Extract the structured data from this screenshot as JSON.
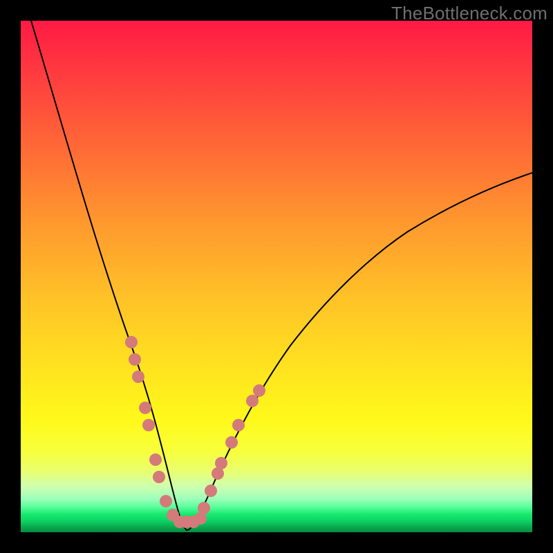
{
  "watermark": "TheBottleneck.com",
  "colors": {
    "background": "#000000",
    "gradient_top": "#ff1a44",
    "gradient_mid": "#ffe31f",
    "gradient_bottom": "#078c41",
    "curve": "#000000",
    "marker": "#d47a7a"
  },
  "chart_data": {
    "type": "line",
    "title": "",
    "xlabel": "",
    "ylabel": "",
    "xlim": [
      0,
      100
    ],
    "ylim": [
      0,
      100
    ],
    "grid": false,
    "legend": false,
    "annotations": [
      "TheBottleneck.com"
    ],
    "series": [
      {
        "name": "curve",
        "x": [
          2,
          5,
          8,
          11,
          14,
          17,
          20,
          22,
          24,
          26,
          28,
          30,
          32,
          36,
          40,
          45,
          50,
          55,
          60,
          65,
          70,
          75,
          80,
          85,
          90,
          95,
          100
        ],
        "y": [
          100,
          90,
          80,
          70,
          61,
          52,
          44,
          36,
          28,
          20,
          12,
          5,
          0,
          6,
          14,
          23,
          31,
          38,
          44,
          49,
          54,
          58,
          62,
          65,
          68,
          71,
          73
        ]
      }
    ],
    "markers": [
      {
        "x": 21.6,
        "y": 37.2
      },
      {
        "x": 22.3,
        "y": 33.8
      },
      {
        "x": 23.0,
        "y": 30.4
      },
      {
        "x": 24.3,
        "y": 24.3
      },
      {
        "x": 25.0,
        "y": 20.9
      },
      {
        "x": 26.4,
        "y": 14.2
      },
      {
        "x": 27.0,
        "y": 10.8
      },
      {
        "x": 28.4,
        "y": 6.1
      },
      {
        "x": 29.7,
        "y": 3.4
      },
      {
        "x": 31.1,
        "y": 2.0
      },
      {
        "x": 32.4,
        "y": 2.0
      },
      {
        "x": 33.8,
        "y": 2.0
      },
      {
        "x": 35.1,
        "y": 2.7
      },
      {
        "x": 35.8,
        "y": 4.7
      },
      {
        "x": 37.2,
        "y": 8.1
      },
      {
        "x": 38.5,
        "y": 11.5
      },
      {
        "x": 39.2,
        "y": 13.5
      },
      {
        "x": 41.2,
        "y": 17.6
      },
      {
        "x": 42.6,
        "y": 20.9
      },
      {
        "x": 45.3,
        "y": 25.7
      },
      {
        "x": 46.6,
        "y": 27.7
      }
    ]
  }
}
